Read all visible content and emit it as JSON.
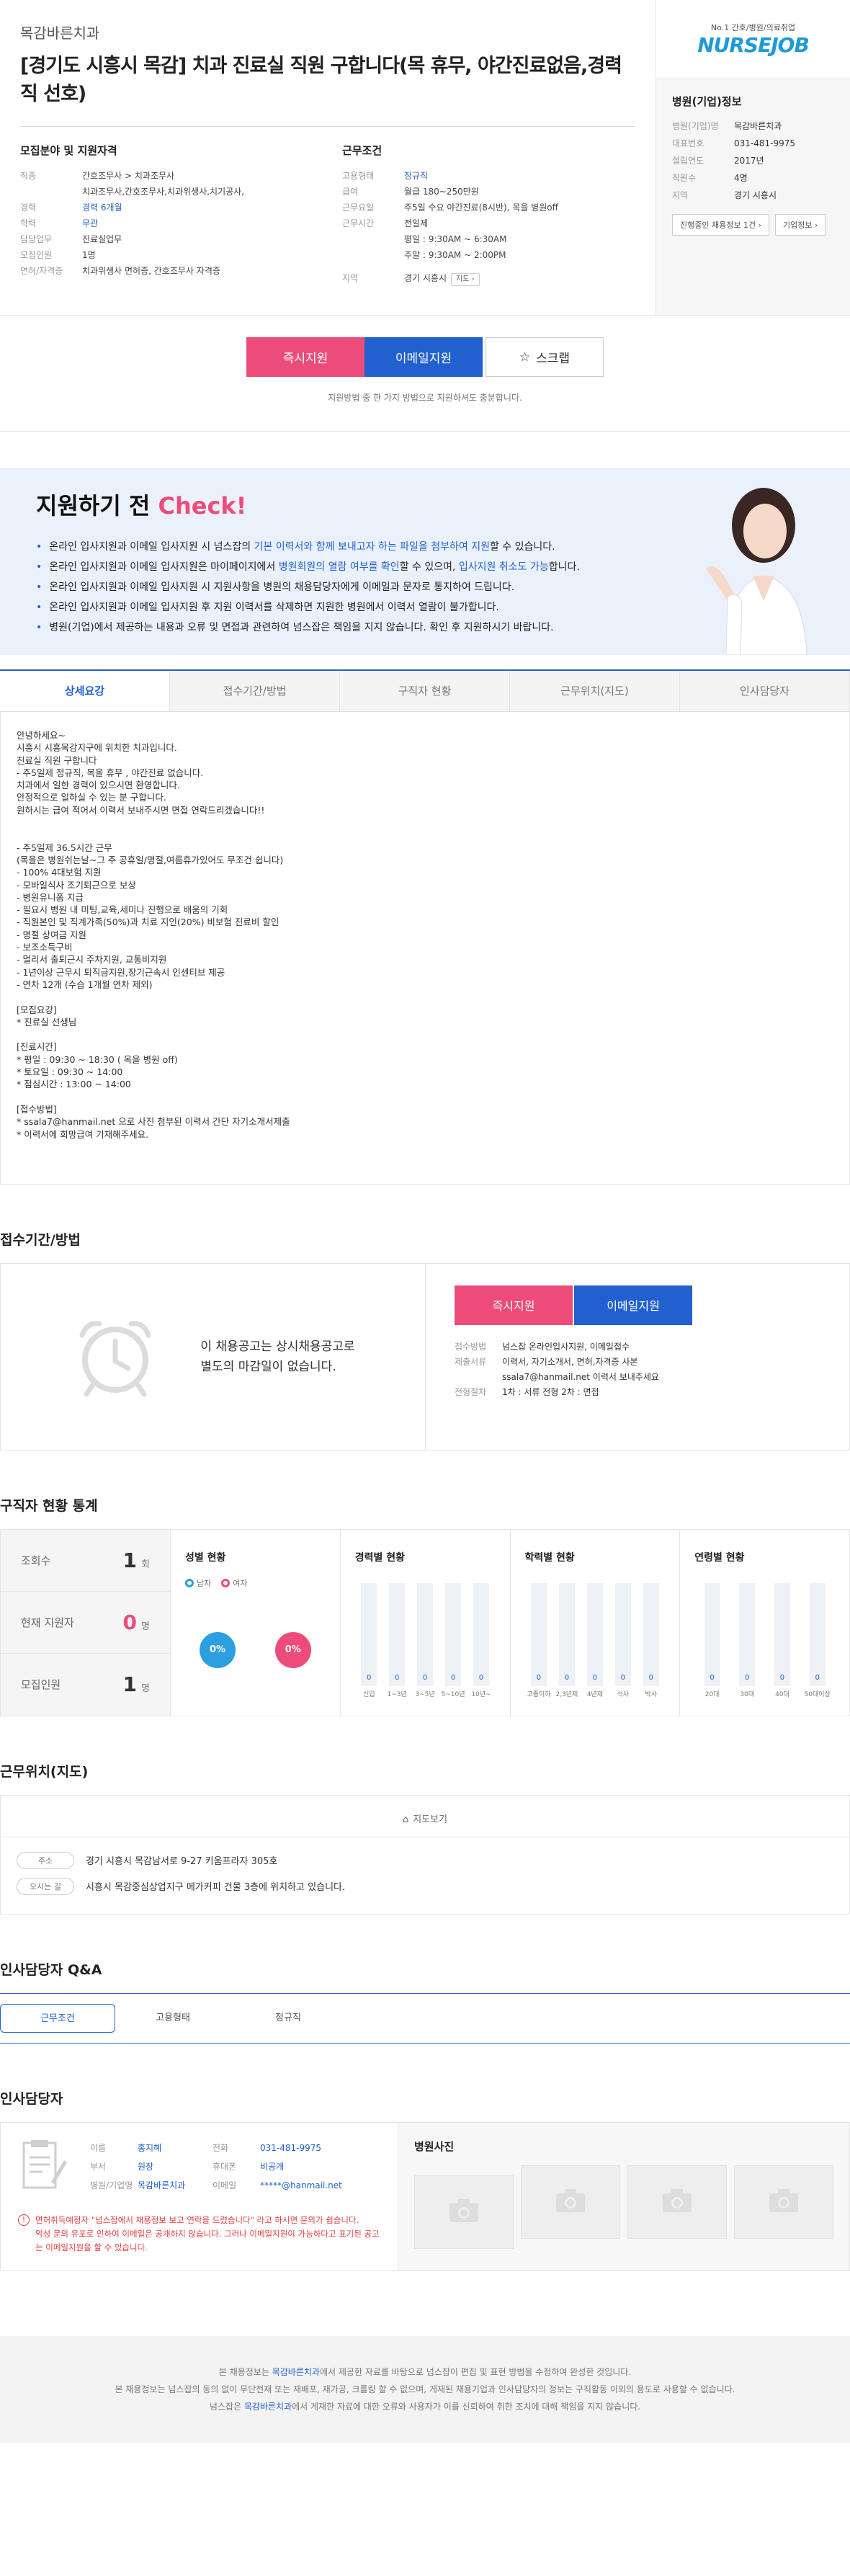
{
  "job": {
    "company": "목감바른치과",
    "title": "[경기도 시흥시 목감] 치과 진료실 직원 구합니다(목 휴무, 야간진료없음,경력직 선호)"
  },
  "recruit": {
    "heading": "모집분야 및 지원자격",
    "rows": [
      {
        "k": "직종",
        "v": "간호조무사 > 치과조무사"
      },
      {
        "k": "",
        "v": "치과조무사,간호조무사,치과위생사,치기공사,"
      },
      {
        "k": "경력",
        "v": "경력 6개월"
      },
      {
        "k": "학력",
        "v": "무관"
      },
      {
        "k": "담당업무",
        "v": "진료실업무"
      },
      {
        "k": "모집인원",
        "v": "1명"
      },
      {
        "k": "면허/자격증",
        "v": "치과위생사 면허증, 간호조무사 자격증"
      }
    ]
  },
  "conditions": {
    "heading": "근무조건",
    "rows": [
      {
        "k": "고용형태",
        "v": "정규직"
      },
      {
        "k": "급여",
        "v": "월급 180~250만원"
      },
      {
        "k": "근무요일",
        "v": "주5일 수요 야간진료(8시반), 목을 병원off"
      },
      {
        "k": "근무시간",
        "v": "전일제"
      },
      {
        "k": "",
        "v": "평일 : 9:30AM ~ 6:30AM"
      },
      {
        "k": "",
        "v": "주말 : 9:30AM ~ 2:00PM"
      }
    ],
    "region_k": "지역",
    "region_v": "경기 시흥시",
    "map_tag": "지도"
  },
  "side": {
    "logo_sub": "No.1 간호/병원/의료취업",
    "logo_main": "NURSEJOB",
    "heading": "병원(기업)정보",
    "rows": [
      {
        "k": "병원(기업)명",
        "v": "목감바른치과"
      },
      {
        "k": "대표번호",
        "v": "031-481-9975"
      },
      {
        "k": "설립연도",
        "v": "2017년"
      },
      {
        "k": "직원수",
        "v": "4명"
      },
      {
        "k": "지역",
        "v": "경기 시흥시"
      }
    ],
    "btn_jobs": "진행중인 채용정보 1건",
    "btn_info": "기업정보"
  },
  "apply": {
    "instant": "즉시지원",
    "email": "이메일지원",
    "scrap": "스크랩",
    "note": "지원방법 중 한 가지 방법으로 지원하셔도 충분합니다."
  },
  "check": {
    "title_pre": "지원하기 전",
    "title_hl": "Check!",
    "items": [
      [
        "온라인 입사지원과 이메일 입사지원 시 넘스잡의 ",
        "기본 이력서와 함께 보내고자 하는 파일을 첨부하여 지원",
        "할 수 있습니다."
      ],
      [
        "온라인 입사지원과 이메일 입사지원은 마이페이지에서 ",
        "병원회원의 열람 여부를 확인",
        "할 수 있으며, ",
        "입사지원 취소도 가능",
        "합니다."
      ],
      [
        "온라인 입사지원과 이메일 입사지원 시 지원사항을 병원의 채용담당자에게 이메일과 문자로 통지하여 드립니다."
      ],
      [
        "온라인 입사지원과 이메일 입사지원 후 지원 이력서를 삭제하면 지원한 병원에서 이력서 열람이 불가합니다."
      ],
      [
        "병원(기업)에서 제공하는 내용과 오류 및 면접과 관련하여 넘스잡은 책임을 지지 않습니다. 확인 후 지원하시기 바랍니다."
      ]
    ]
  },
  "tabs": [
    "상세요강",
    "접수기간/방법",
    "구직자 현황",
    "근무위치(지도)",
    "인사담당자"
  ],
  "detail": "안녕하세요~\n시흥시 시흥목감지구에 위치한 치과입니다.\n진료실 직원 구합니다\n- 주5일제 정규직, 목을 휴무 , 야간진료 없습니다.\n치과에서 일한 경력이 있으시면 환영합니다.\n안정적으로 일하실 수 있는 분 구합니다.\n원하시는 급여 적어서 이력서 보내주시면 면접 연락드리겠습니다!!\n\n\n- 주5일제 36.5시간 근무\n (목을은 병원쉬는날~그 주 공휴일/명절,여름휴가있어도 무조건 쉽니다)\n- 100% 4대보험 지원\n- 모바일식사 조기퇴근으로 보상\n- 병원유니폼 지급\n- 필요시 병원 내 미팅,교육,세미나 진행으로 배움의 기회\n- 직원본인 및 직계가족(50%)과 치료 지인(20%) 비보험 진료비 할인\n- 명절 상여금 지원\n- 보조소득구비\n- 멀리서 출퇴근시 주차지원, 교통비지원\n- 1년이상 근무시 퇴직금지원,장기근속시 인센티브 제공\n- 연차 12개 (수습 1개월 연차 제외)\n\n[모집요강]\n* 진료실 선생님\n\n[진료시간]\n* 평일 : 09:30 ~ 18:30 ( 목을 병원 off)\n* 토요일 : 09:30 ~ 14:00\n* 점심시간 : 13:00 ~ 14:00\n\n[접수방법]\n* ssala7@hanmail.net 으로 사진 첨부된 이력서  간단 자기소개서제출\n* 이력서에 희망급여 기재해주세요.",
  "deadline": {
    "title": "접수기간/방법",
    "text1": "이 채용공고는 상시채용공고로",
    "text2": "별도의 마감일이 없습니다.",
    "rows": [
      {
        "k": "접수방법",
        "v": "넘스잡 온라인입사지원, 이메일접수"
      },
      {
        "k": "제출서류",
        "v": "이력서, 자기소개서, 면허,자격증 사본"
      },
      {
        "k": "",
        "v": "ssala7@hanmail.net 이력서 보내주세요"
      },
      {
        "k": "전형절차",
        "v": "1차 : 서류 전형    2차 : 면접"
      }
    ]
  },
  "stats": {
    "title": "구직자 현황 통계",
    "left": [
      {
        "k": "조회수",
        "v": "1",
        "u": "회"
      },
      {
        "k": "현재 지원자",
        "v": "0",
        "u": "명"
      },
      {
        "k": "모집인원",
        "v": "1",
        "u": "명"
      }
    ],
    "gender": {
      "title": "성별 현황",
      "male": "남자",
      "female": "여자",
      "male_v": "0%",
      "female_v": "0%"
    },
    "career": {
      "title": "경력별 현황",
      "labels": [
        "신입",
        "1~3년",
        "3~5년",
        "5~10년",
        "10년~"
      ],
      "values": [
        "0",
        "0",
        "0",
        "0",
        "0"
      ]
    },
    "edu": {
      "title": "학력별 현황",
      "labels": [
        "고졸이하",
        "2,3년제",
        "4년제",
        "석사",
        "박사"
      ],
      "values": [
        "0",
        "0",
        "0",
        "0",
        "0"
      ]
    },
    "age": {
      "title": "연령별 현황",
      "labels": [
        "20대",
        "30대",
        "40대",
        "50대이상"
      ],
      "values": [
        "0",
        "0",
        "0",
        "0"
      ]
    }
  },
  "map": {
    "title": "근무위치(지도)",
    "btn": "지도보기",
    "addr_k": "주소",
    "addr_v": "경기 시흥시 목감남서로 9-27 키움프라자 305호",
    "way_k": "오시는 길",
    "way_v": "시흥시 목감중심상업지구 메가커피 건물 3층에 위치하고 있습니다."
  },
  "qa": {
    "title": "인사담당자 Q&A",
    "tabs": [
      "근무조건",
      "고용형태",
      "정규직"
    ]
  },
  "manager": {
    "title": "인사담당자",
    "cells": [
      {
        "k": "이름",
        "v": "홍지혜"
      },
      {
        "k": "전화",
        "v": "031-481-9975"
      },
      {
        "k": "부서",
        "v": "원장"
      },
      {
        "k": "휴대폰",
        "v": "비공개"
      },
      {
        "k": "병원/기업명",
        "v": "목감바른치과"
      },
      {
        "k": "이메일",
        "v": "*****@hanmail.net"
      }
    ],
    "warn1": "면허취득예정자 \"넘스잡에서 채용정보 보고 연락을 드렸습니다\" 라고 하시면 문의가 쉽습니다.",
    "warn2": "악성 문의 유포로 인하여 이메일은 공개하지 않습니다. 그러나 이메일지원이 가능하다고 표기된 공고는 이메일지원을 할 수 있습니다.",
    "photo_title": "병원사진"
  },
  "footer": {
    "l1_pre": "본 채용정보는 ",
    "l1_hl": "목감바른치과",
    "l1_post": "에서 제공한 자료를 바탕으로 넘스잡이 편집 및 표현 방법을 수정하여 완성한 것입니다.",
    "l2": "본 채용정보는 넘스잡의 동의 없이 무단전재 또는 재배포, 재가공, 크롤링 할 수 없으며, 게재된 채용기업과 인사담당자의 정보는 구직활동 이외의 용도로 사용할 수 없습니다.",
    "l3_pre": "넘스잡은 ",
    "l3_hl": "목감바른치과",
    "l3_post": "에서 게재한 자료에 대한 오류와 사용자가 이를 신뢰하여 취한 조치에 대해 책임을 지지 않습니다."
  }
}
